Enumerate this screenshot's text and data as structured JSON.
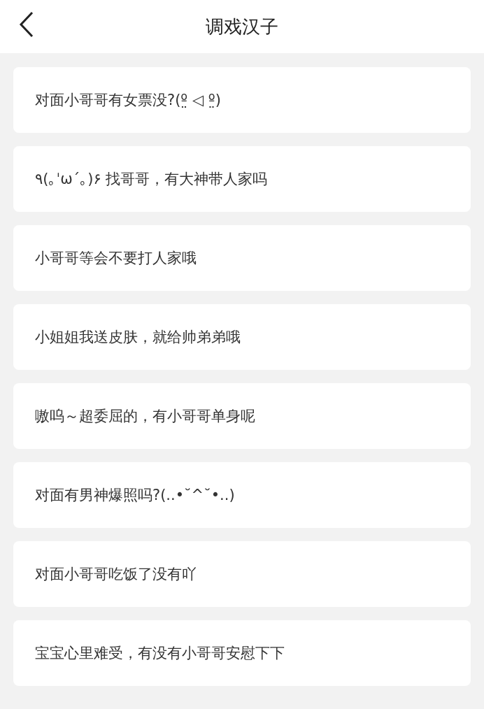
{
  "header": {
    "title": "调戏汉子"
  },
  "messages": [
    {
      "text": "对面小哥哥有女票没?(º̤ ◁ º̤)"
    },
    {
      "text": "٩(｡ˈωˊ｡)۶ 找哥哥，有大神带人家吗"
    },
    {
      "text": "小哥哥等会不要打人家哦"
    },
    {
      "text": "小姐姐我送皮肤，就给帅弟弟哦"
    },
    {
      "text": "嗷呜～超委屈的，有小哥哥单身呢"
    },
    {
      "text": "对面有男神爆照吗?(..•˘^˘•..)"
    },
    {
      "text": "对面小哥哥吃饭了没有吖"
    },
    {
      "text": "宝宝心里难受，有没有小哥哥安慰下下"
    }
  ]
}
